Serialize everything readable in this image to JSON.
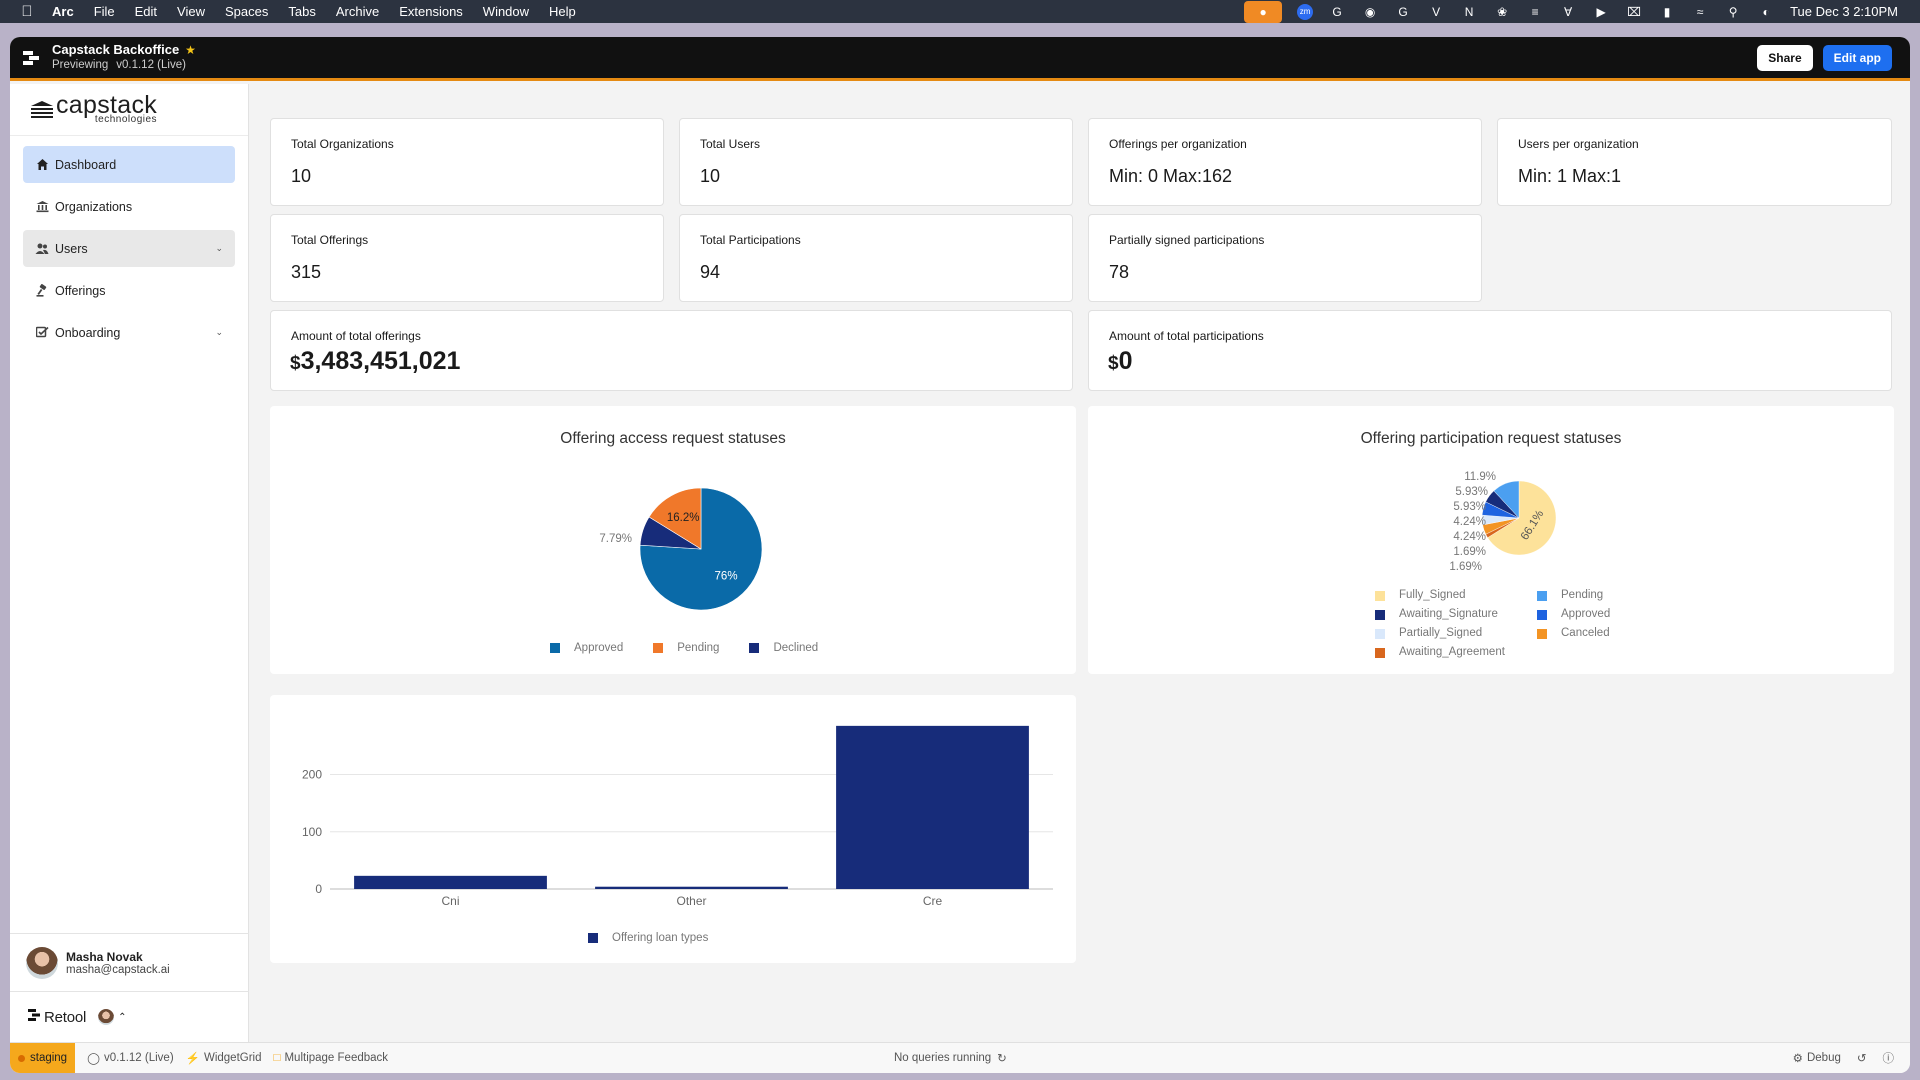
{
  "menubar": {
    "app": "Arc",
    "items": [
      "File",
      "Edit",
      "View",
      "Spaces",
      "Tabs",
      "Archive",
      "Extensions",
      "Window",
      "Help"
    ],
    "clock": "Tue Dec 3  2:10PM"
  },
  "window": {
    "title": "Capstack Backoffice",
    "mode": "Previewing",
    "version": "v0.1.12 (Live)",
    "share_label": "Share",
    "edit_label": "Edit app"
  },
  "sidebar": {
    "brand": "capstack",
    "brand_sub": "technologies",
    "items": [
      {
        "label": "Dashboard"
      },
      {
        "label": "Organizations"
      },
      {
        "label": "Users"
      },
      {
        "label": "Offerings"
      },
      {
        "label": "Onboarding"
      }
    ],
    "user": {
      "name": "Masha Novak",
      "email": "masha@capstack.ai"
    },
    "retool_label": "Retool"
  },
  "stats": {
    "total_orgs": {
      "label": "Total Organizations",
      "value": "10"
    },
    "total_users": {
      "label": "Total Users",
      "value": "10"
    },
    "offerings_per_org": {
      "label": "Offerings per organization",
      "value": "Min: 0 Max:162"
    },
    "users_per_org": {
      "label": "Users per organization",
      "value": "Min: 1 Max:1"
    },
    "total_offerings": {
      "label": "Total Offerings",
      "value": "315"
    },
    "total_participations": {
      "label": "Total Participations",
      "value": "94"
    },
    "partially_signed": {
      "label": "Partially signed participations",
      "value": "78"
    },
    "amount_offerings": {
      "label": "Amount of total offerings",
      "currency": "$",
      "value": "3,483,451,021"
    },
    "amount_participations": {
      "label": "Amount of total participations",
      "currency": "$",
      "value": "0"
    }
  },
  "chart_data": [
    {
      "type": "pie",
      "title": "Offering access request statuses",
      "labels": [
        "Approved",
        "Pending",
        "Declined"
      ],
      "values": [
        76,
        16.2,
        7.79
      ],
      "value_labels": [
        "76%",
        "16.2%",
        "7.79%"
      ],
      "colors": [
        "#0a6aa8",
        "#f0782a",
        "#172c7a"
      ]
    },
    {
      "type": "pie",
      "title": "Offering participation request statuses",
      "labels": [
        "Fully_Signed",
        "Pending",
        "Awaiting_Signature",
        "Approved",
        "Partially_Signed",
        "Canceled",
        "Awaiting_Agreement"
      ],
      "values": [
        66.1,
        11.9,
        5.93,
        5.93,
        4.24,
        4.24,
        1.69
      ],
      "value_labels": [
        "66.1%",
        "11.9%",
        "5.93%",
        "5.93%",
        "4.24%",
        "4.24%",
        "1.69%"
      ],
      "colors": [
        "#fde29a",
        "#4b9ff0",
        "#172c7a",
        "#1e63e0",
        "#d9e8fb",
        "#f39424",
        "#d8671e"
      ]
    },
    {
      "type": "bar",
      "categories": [
        "Cni",
        "Other",
        "Cre"
      ],
      "series": [
        {
          "name": "Offering loan types",
          "values": [
            23,
            4,
            285
          ],
          "color": "#172c7a"
        }
      ],
      "ylim": [
        0,
        290
      ],
      "yticks": [
        "0",
        "100",
        "200"
      ],
      "grid": true,
      "legend": "bottom"
    }
  ],
  "statusbar": {
    "env": "staging",
    "version": "v0.1.12 (Live)",
    "widget": "WidgetGrid",
    "feedback": "Multipage Feedback",
    "queries": "No queries running",
    "debug": "Debug"
  }
}
